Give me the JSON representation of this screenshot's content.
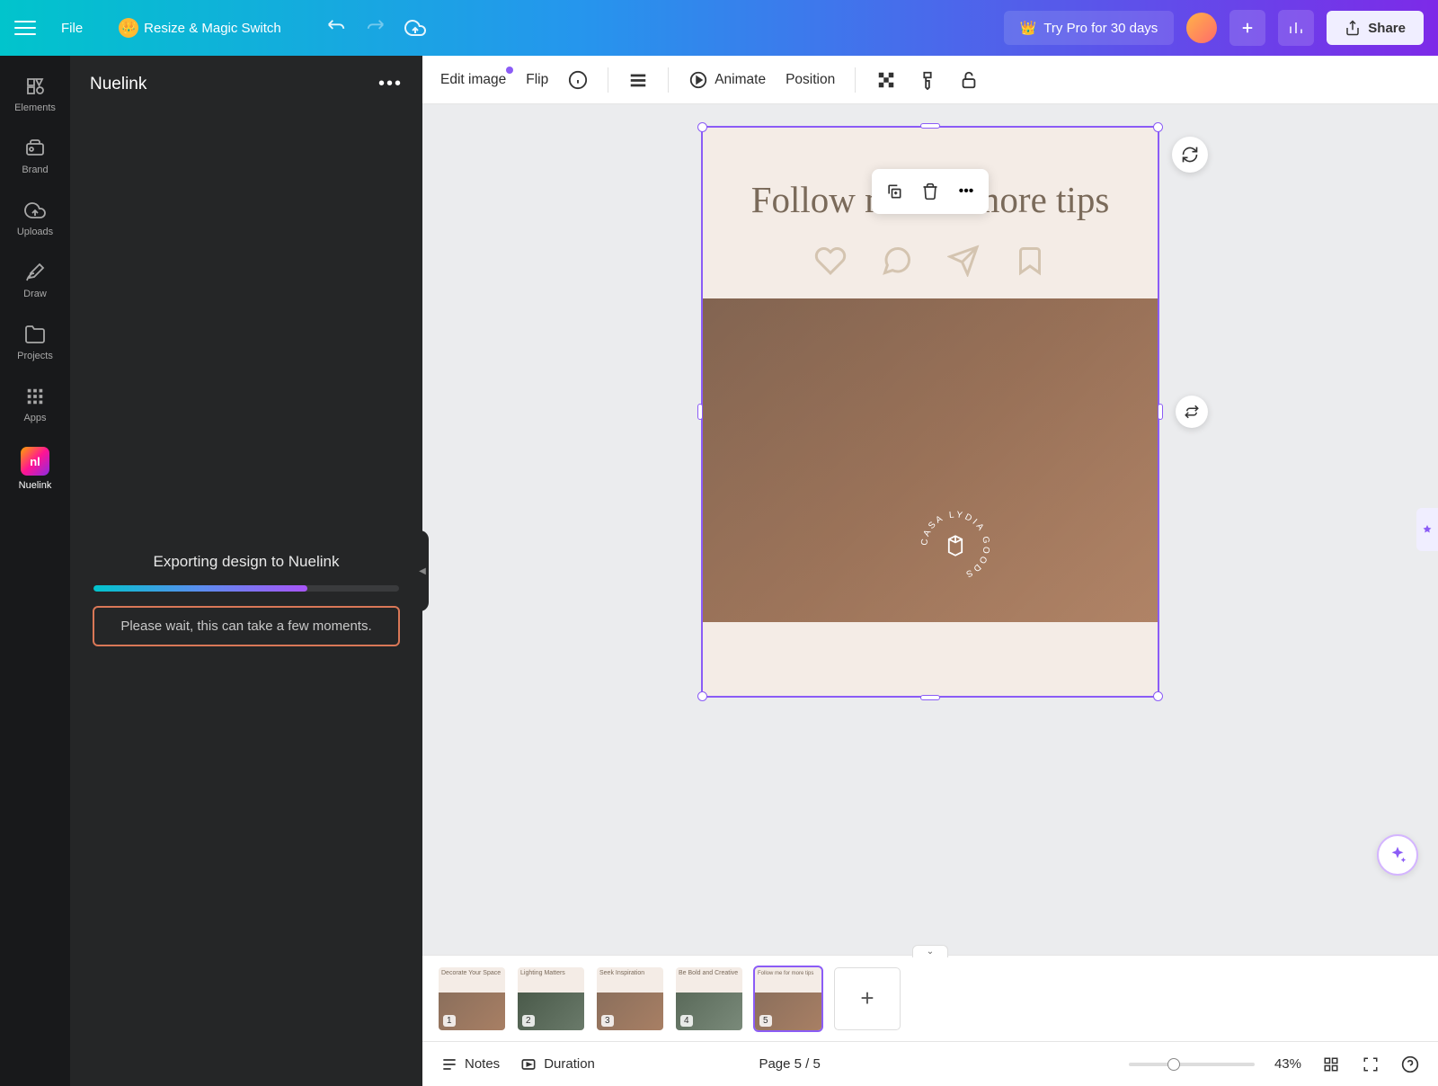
{
  "topbar": {
    "file": "File",
    "resize": "Resize & Magic Switch",
    "try_pro": "Try Pro for 30 days",
    "share": "Share"
  },
  "nav": {
    "elements": "Elements",
    "brand": "Brand",
    "uploads": "Uploads",
    "draw": "Draw",
    "projects": "Projects",
    "apps": "Apps",
    "nuelink": "Nuelink"
  },
  "sidebar": {
    "title": "Nuelink",
    "export_title": "Exporting design to Nuelink",
    "wait_message": "Please wait, this can take a few moments."
  },
  "toolbar": {
    "edit_image": "Edit image",
    "flip": "Flip",
    "animate": "Animate",
    "position": "Position"
  },
  "design": {
    "heading": "Follow me for more tips",
    "logo_text": "CASA LYDIA GOODS"
  },
  "thumbnails": [
    {
      "num": "1",
      "title": "Decorate Your Space"
    },
    {
      "num": "2",
      "title": "Lighting Matters"
    },
    {
      "num": "3",
      "title": "Seek Inspiration"
    },
    {
      "num": "4",
      "title": "Be Bold and Creative"
    },
    {
      "num": "5",
      "title": "Follow me for more tips"
    }
  ],
  "bottom": {
    "notes": "Notes",
    "duration": "Duration",
    "page_indicator": "Page 5 / 5",
    "zoom": "43%"
  }
}
